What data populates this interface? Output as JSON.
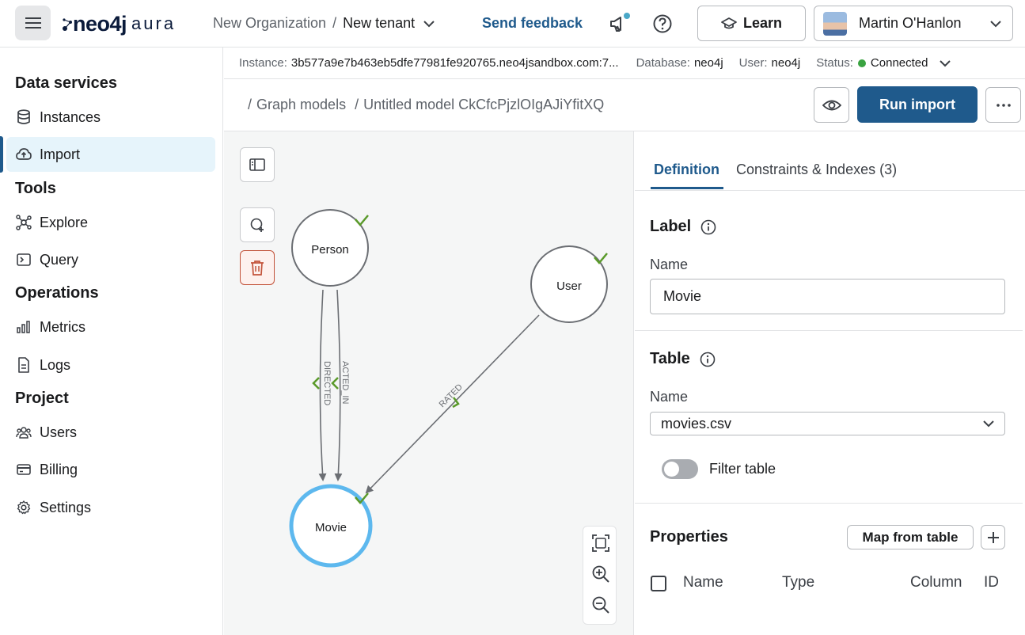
{
  "topbar": {
    "logo_main": "neo4j",
    "logo_sub": "aura",
    "org": "New Organization",
    "sep": "/",
    "tenant": "New tenant",
    "feedback": "Send feedback",
    "learn": "Learn",
    "user": "Martin O'Hanlon"
  },
  "sidebar": {
    "sections": {
      "data_services": "Data services",
      "tools": "Tools",
      "operations": "Operations",
      "project": "Project"
    },
    "items": {
      "instances": "Instances",
      "import": "Import",
      "explore": "Explore",
      "query": "Query",
      "metrics": "Metrics",
      "logs": "Logs",
      "users": "Users",
      "billing": "Billing",
      "settings": "Settings"
    }
  },
  "instance_bar": {
    "instance_label": "Instance:",
    "instance_value": "3b577a9e7b463eb5dfe77981fe920765.neo4jsandbox.com:7...",
    "database_label": "Database:",
    "database_value": "neo4j",
    "user_label": "User:",
    "user_value": "neo4j",
    "status_label": "Status:",
    "status_value": "Connected",
    "status_color": "#3aa341"
  },
  "breadcrumb": {
    "sep": "/",
    "graph_models": "Graph models",
    "model": "Untitled model CkCfcPjzlOIgAJiYfitXQ"
  },
  "actions": {
    "run_import": "Run import"
  },
  "graph": {
    "nodes": {
      "person": "Person",
      "user": "User",
      "movie": "Movie"
    },
    "relationships": {
      "directed": "DIRECTED",
      "acted_in": "ACTED_IN",
      "rated": "RATED"
    }
  },
  "panel": {
    "tabs": {
      "definition": "Definition",
      "constraints": "Constraints & Indexes (3)"
    },
    "label_section": "Label",
    "label_name_label": "Name",
    "label_name_value": "Movie",
    "table_section": "Table",
    "table_name_label": "Name",
    "table_name_value": "movies.csv",
    "filter_table": "Filter table",
    "properties_section": "Properties",
    "map_from_table": "Map from table",
    "columns": {
      "name": "Name",
      "type": "Type",
      "column": "Column",
      "id": "ID"
    }
  },
  "colors": {
    "brand": "#1f5a8c",
    "selected_node": "#5db8ee",
    "check": "#5a9a2a",
    "danger": "#c2533a"
  }
}
